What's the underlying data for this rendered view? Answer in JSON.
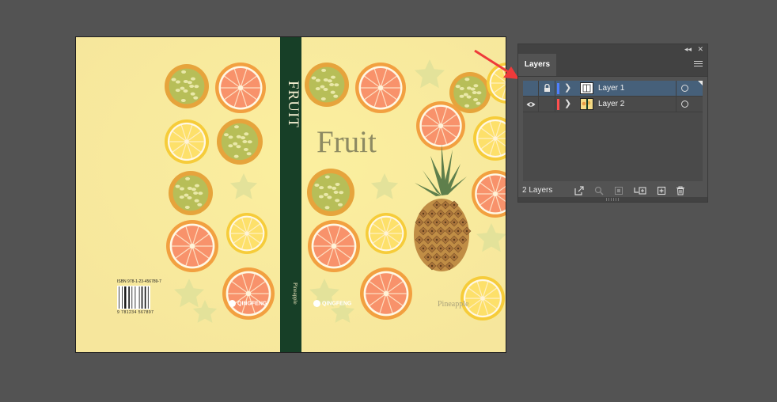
{
  "artboard": {
    "spine_title": "FRUIT",
    "spine_subtitle": "Pineapple",
    "front_title": "Fruit",
    "front_subtitle": "Pineapple",
    "brand_name": "QINGFENG",
    "isbn_label": "ISBN 978-1-23-456789-7",
    "isbn_digits": "9 781234 567897"
  },
  "panel": {
    "tab_label": "Layers",
    "collapse_icon": "double-chevron-left-icon",
    "close_icon": "close-icon",
    "menu_icon": "hamburger-menu-icon",
    "layers": [
      {
        "name": "Layer 1",
        "visible": false,
        "locked": true,
        "color": "#4f7fff",
        "selected": true
      },
      {
        "name": "Layer 2",
        "visible": true,
        "locked": false,
        "color": "#ff4f4f",
        "selected": false
      }
    ],
    "footer": {
      "count_label": "2 Layers",
      "buttons": [
        "export-icon",
        "locate-object-icon",
        "clipping-mask-icon",
        "create-sublayer-icon",
        "new-layer-icon",
        "trash-icon"
      ]
    }
  },
  "colors": {
    "workspace": "#535353",
    "panel_selected": "#46607a",
    "spine": "#173f27",
    "arrow": "#ee3a3a"
  }
}
